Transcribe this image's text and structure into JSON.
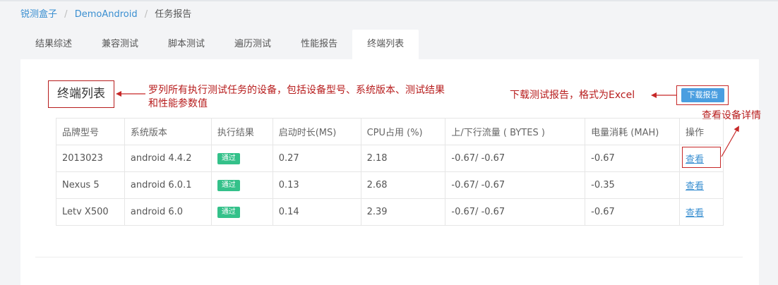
{
  "breadcrumb": {
    "root": "锐测盒子",
    "project": "DemoAndroid",
    "current": "任务报告"
  },
  "tabs": [
    {
      "label": "结果综述",
      "active": false
    },
    {
      "label": "兼容测试",
      "active": false
    },
    {
      "label": "脚本测试",
      "active": false
    },
    {
      "label": "遍历测试",
      "active": false
    },
    {
      "label": "性能报告",
      "active": false
    },
    {
      "label": "终端列表",
      "active": true
    }
  ],
  "section": {
    "title": "终端列表",
    "download_label": "下载报告"
  },
  "annotations": {
    "title_note": "罗列所有执行测试任务的设备，包括设备型号、系统版本、测试结果和性能参数值",
    "download_note": "下载测试报告，格式为Excel",
    "view_note": "查看设备详情"
  },
  "table": {
    "headers": [
      "品牌型号",
      "系统版本",
      "执行结果",
      "启动时长(MS)",
      "CPU占用 (%)",
      "上/下行流量 ( BYTES )",
      "电量消耗 (MAH)",
      "操作"
    ],
    "rows": [
      {
        "model": "2013023",
        "os": "android 4.4.2",
        "result": "通过",
        "startup": "0.27",
        "cpu": "2.18",
        "traffic": "-0.67/ -0.67",
        "power": "-0.67",
        "action": "查看"
      },
      {
        "model": "Nexus 5",
        "os": "android 6.0.1",
        "result": "通过",
        "startup": "0.13",
        "cpu": "2.68",
        "traffic": "-0.67/ -0.67",
        "power": "-0.35",
        "action": "查看"
      },
      {
        "model": "Letv X500",
        "os": "android 6.0",
        "result": "通过",
        "startup": "0.14",
        "cpu": "2.39",
        "traffic": "-0.67/ -0.67",
        "power": "-0.67",
        "action": "查看"
      }
    ]
  },
  "colors": {
    "link": "#3a8fd1",
    "annotation": "#b71c1c",
    "pass_badge": "#34c18a",
    "download_button": "#4a9ee0"
  }
}
